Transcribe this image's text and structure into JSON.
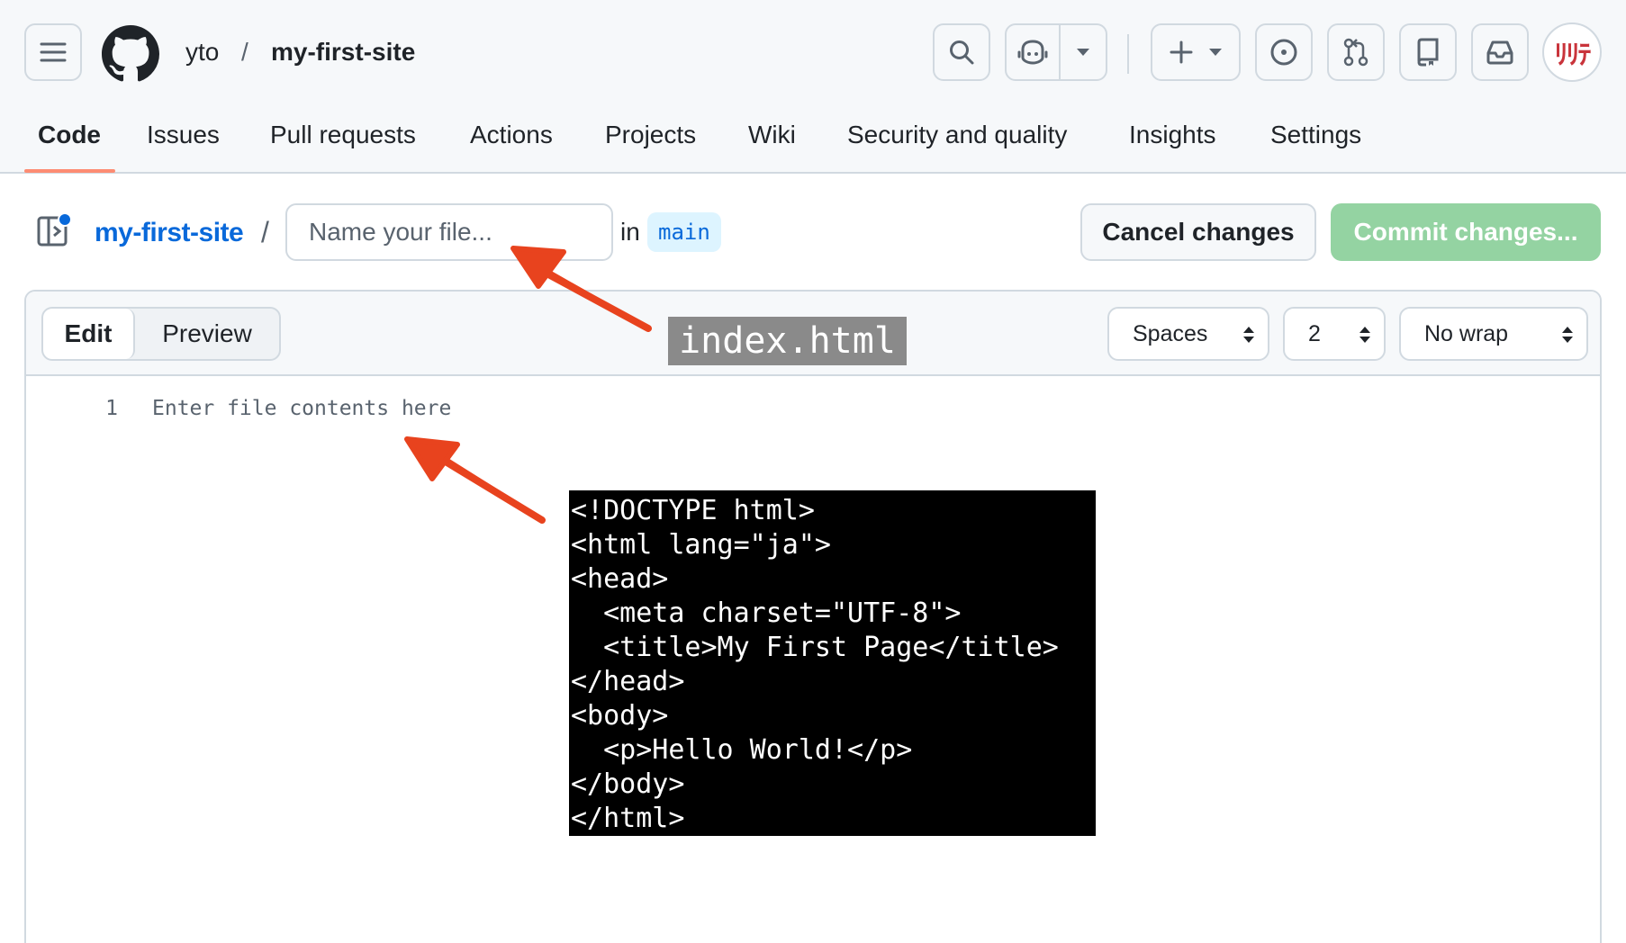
{
  "header": {
    "owner": "yto",
    "separator": "/",
    "repo": "my-first-site",
    "avatar_text": "ﾘﾘﾃ",
    "icons": [
      "menu-icon",
      "github-logo-icon",
      "search-icon",
      "copilot-icon",
      "chevron-down-icon",
      "plus-icon",
      "issue-icon",
      "pull-request-icon",
      "repo-icon",
      "inbox-icon"
    ]
  },
  "tabs": [
    {
      "label": "Code",
      "active": true
    },
    {
      "label": "Issues"
    },
    {
      "label": "Pull requests"
    },
    {
      "label": "Actions"
    },
    {
      "label": "Projects"
    },
    {
      "label": "Wiki"
    },
    {
      "label": "Security and quality"
    },
    {
      "label": "Insights"
    },
    {
      "label": "Settings"
    }
  ],
  "file_bar": {
    "repo_link": "my-first-site",
    "separator": "/",
    "filename_placeholder": "Name your file...",
    "in_label": "in",
    "branch": "main",
    "cancel_label": "Cancel changes",
    "commit_label": "Commit changes..."
  },
  "editor": {
    "edit_label": "Edit",
    "preview_label": "Preview",
    "indent_mode": "Spaces",
    "indent_size": "2",
    "wrap_mode": "No wrap",
    "line_number": "1",
    "placeholder_text": "Enter file contents here"
  },
  "annotations": {
    "filename_label": "index.html",
    "code": "<!DOCTYPE html>\n<html lang=\"ja\">\n<head>\n  <meta charset=\"UTF-8\">\n  <title>My First Page</title>\n</head>\n<body>\n  <p>Hello World!</p>\n</body>\n</html>",
    "arrow_color": "#e8431e"
  },
  "colors": {
    "accent_link": "#0969da",
    "commit_disabled": "#94d3a2",
    "tab_underline": "#fd8c73"
  }
}
